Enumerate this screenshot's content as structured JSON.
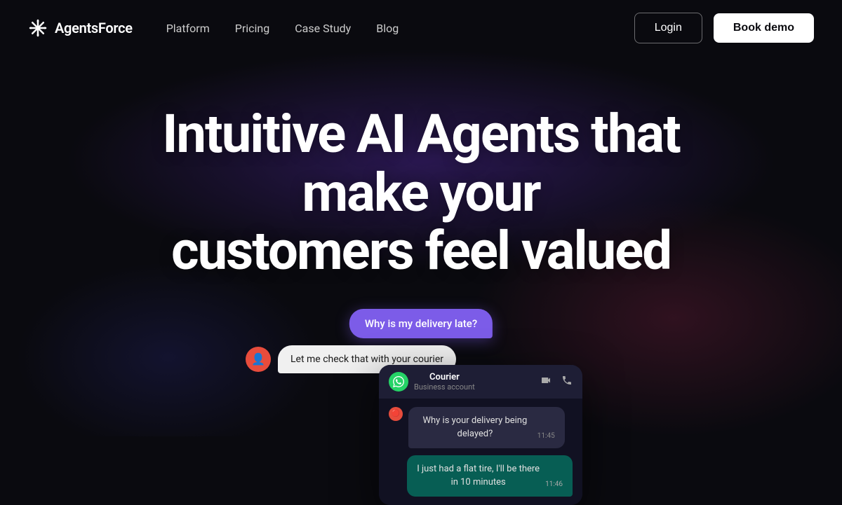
{
  "brand": {
    "name": "AgentsForce",
    "icon_label": "agents-force-icon"
  },
  "nav": {
    "links": [
      {
        "label": "Platform",
        "href": "#",
        "id": "platform"
      },
      {
        "label": "Pricing",
        "href": "#",
        "id": "pricing"
      },
      {
        "label": "Case Study",
        "href": "#",
        "id": "case-study"
      },
      {
        "label": "Blog",
        "href": "#",
        "id": "blog"
      }
    ],
    "login_label": "Login",
    "book_demo_label": "Book demo"
  },
  "hero": {
    "title_line1": "Intuitive AI Agents that make your",
    "title_line2": "customers feel valued"
  },
  "chat": {
    "bubble_purple_text": "Why is my delivery late?",
    "agent_message": "Let me check that with your courier",
    "card_title": "Courier",
    "card_subtitle": "Business account",
    "received_msg": "Why is your delivery being delayed?",
    "received_time": "11:45",
    "sent_msg": "I just had a flat tire, I'll be there in 10 minutes",
    "sent_time": "11:46"
  }
}
